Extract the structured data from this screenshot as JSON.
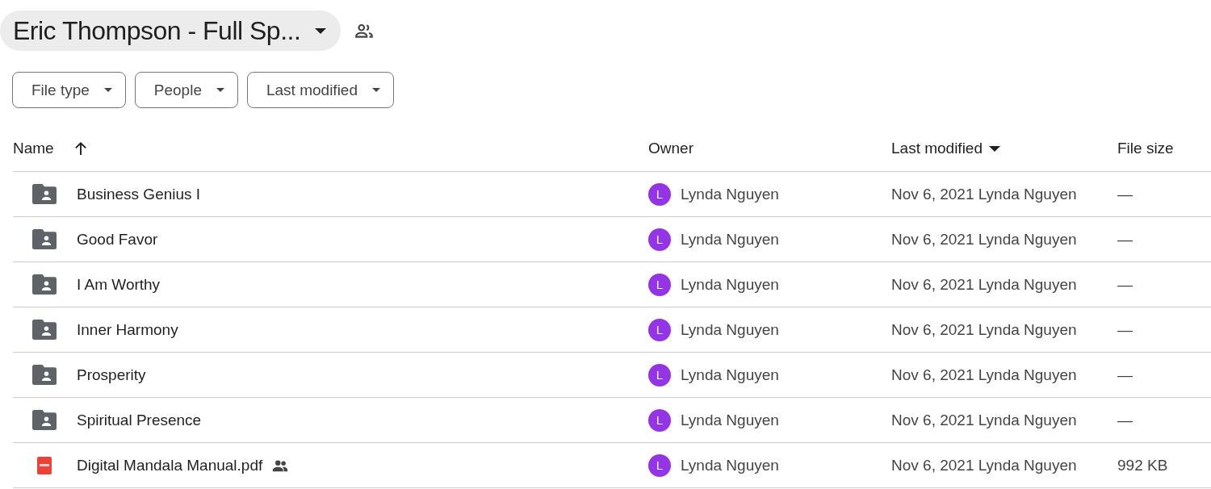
{
  "breadcrumb": {
    "title": "Eric Thompson - Full Sp...",
    "shared": true
  },
  "filters": [
    "File type",
    "People",
    "Last modified"
  ],
  "table": {
    "columns": [
      {
        "label": "Name",
        "sorted": true,
        "descending": false
      },
      {
        "label": "Owner",
        "sorted": false
      },
      {
        "label": "Last modified",
        "sorted": true,
        "descending": true
      },
      {
        "label": "File size",
        "sorted": false
      }
    ],
    "rows": [
      {
        "kind": "folder",
        "name": "Business Genius I",
        "shared": false,
        "owner_initial": "L",
        "owner": "Lynda Nguyen",
        "modified": "Nov 6, 2021 Lynda Nguyen",
        "size": "—"
      },
      {
        "kind": "folder",
        "name": "Good Favor",
        "shared": false,
        "owner_initial": "L",
        "owner": "Lynda Nguyen",
        "modified": "Nov 6, 2021 Lynda Nguyen",
        "size": "—"
      },
      {
        "kind": "folder",
        "name": "I Am Worthy",
        "shared": false,
        "owner_initial": "L",
        "owner": "Lynda Nguyen",
        "modified": "Nov 6, 2021 Lynda Nguyen",
        "size": "—"
      },
      {
        "kind": "folder",
        "name": "Inner Harmony",
        "shared": false,
        "owner_initial": "L",
        "owner": "Lynda Nguyen",
        "modified": "Nov 6, 2021 Lynda Nguyen",
        "size": "—"
      },
      {
        "kind": "folder",
        "name": "Prosperity",
        "shared": false,
        "owner_initial": "L",
        "owner": "Lynda Nguyen",
        "modified": "Nov 6, 2021 Lynda Nguyen",
        "size": "—"
      },
      {
        "kind": "folder",
        "name": "Spiritual Presence",
        "shared": false,
        "owner_initial": "L",
        "owner": "Lynda Nguyen",
        "modified": "Nov 6, 2021 Lynda Nguyen",
        "size": "—"
      },
      {
        "kind": "pdf",
        "name": "Digital Mandala Manual.pdf",
        "shared": true,
        "owner_initial": "L",
        "owner": "Lynda Nguyen",
        "modified": "Nov 6, 2021 Lynda Nguyen",
        "size": "992 KB"
      }
    ]
  }
}
